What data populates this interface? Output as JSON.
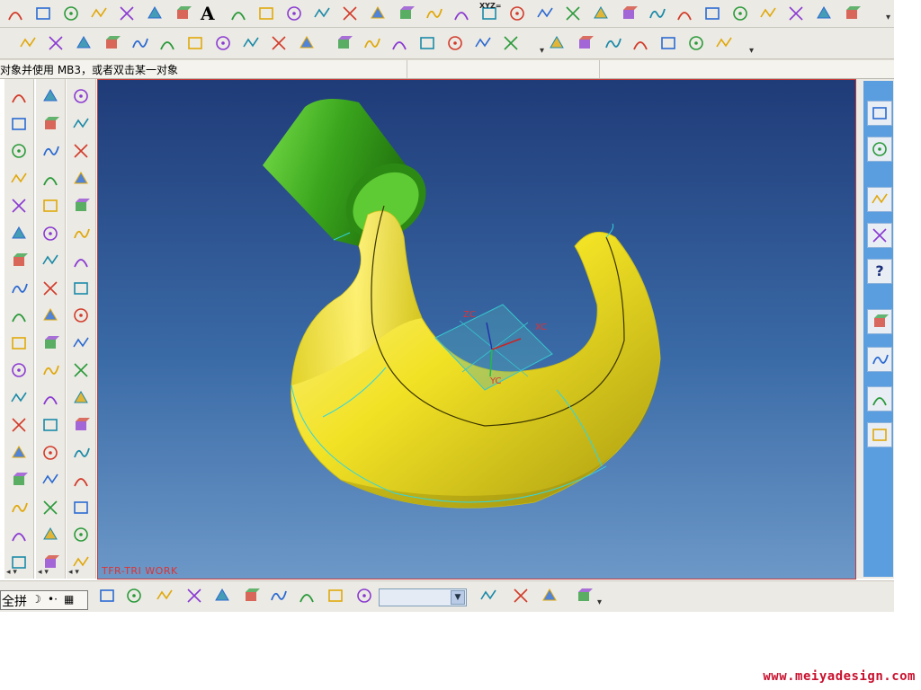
{
  "top_toolbar_1": {
    "icons": [
      "arc-icon",
      "helix-icon",
      "spline-icon",
      "curve-icon",
      "wave-icon",
      "polyline-icon",
      "sketch-icon",
      "text-icon",
      "point-icon",
      "point-set-icon",
      "fillet-curve-icon",
      "rectangle-icon",
      "polygon-icon",
      "circle-icon",
      "intersection-icon",
      "trim-icon",
      "chamfer-curve-icon",
      "xyz-expression-icon",
      "law-curve-icon",
      "offset-curve-icon",
      "bridge-curve-icon",
      "project-curve-icon",
      "combined-curve-icon",
      "wrap-curve-icon",
      "extract-curve-icon",
      "section-curve-icon",
      "isoparametric-icon",
      "mirror-curve-icon",
      "divide-curve-icon",
      "edit-parameters-icon",
      "pencil-icon"
    ],
    "text_icon_label": "A",
    "xyz_label": "XYZ="
  },
  "top_toolbar_2": {
    "icons": [
      "line-icon",
      "line-angle-icon",
      "line-parallel-icon",
      "line-normal-icon",
      "arc-3point-icon",
      "arc-tangent-icon",
      "grid-curve-icon",
      "arc-edit-icon",
      "line-edit-icon",
      "trim-corner-icon",
      "trim-edge-icon",
      "circle-center-icon",
      "circle-3point-icon",
      "square-circle-icon",
      "circle-tangent-icon",
      "point-center-icon",
      "circle-radius-icon",
      "circle-dash-icon",
      "line-slash-icon",
      "line-dash-icon",
      "curve-edit-icon",
      "perpendicular-icon",
      "circle-outline-icon",
      "circle-plus-icon",
      "cross-icon"
    ]
  },
  "status_bar": {
    "prompt": "对象并使用 MB3，或者双击某一对象"
  },
  "left_toolbar_columns": [
    {
      "icons": [
        "mesh-surface-icon",
        "through-points-icon",
        "from-poles-icon",
        "ruled-surface-icon",
        "through-curves-icon",
        "curve-mesh-icon",
        "swept-icon",
        "section-surface-icon",
        "bridge-surface-icon",
        "n-sided-icon",
        "extension-icon",
        "law-extension-icon",
        "offset-surface-icon",
        "rough-offset-icon",
        "transition-icon",
        "trimmed-sheet-icon",
        "quilt-icon",
        "silhouette-flange-icon"
      ]
    },
    {
      "icons": [
        "extrude-icon",
        "revolve-icon",
        "block-icon",
        "sweep-icon",
        "cylinder-icon",
        "cone-icon",
        "tube-icon",
        "rib-icon",
        "hole-icon",
        "boss-icon",
        "pocket-icon",
        "pad-icon",
        "slot-icon",
        "groove-icon",
        "thread-icon",
        "emboss-icon",
        "blend-icon",
        "face-blend-icon",
        "chamfer-icon"
      ]
    },
    {
      "icons": [
        "part-navigator-icon",
        "assembly-icon",
        "feature-icon",
        "draft-icon",
        "pipe-icon",
        "shell-icon",
        "boolean-unite-icon",
        "boolean-subtract-icon",
        "boolean-intersect-icon",
        "offset-face-icon",
        "scale-body-icon",
        "trim-body-icon",
        "split-body-icon",
        "sew-icon",
        "patch-icon",
        "simplify-icon",
        "wrap-geometry-icon",
        "promote-icon"
      ]
    }
  ],
  "viewport": {
    "work_layer_label": "TFR-TRI WORK",
    "axis_labels": {
      "z": "ZC",
      "x": "XC",
      "y": "YC"
    }
  },
  "right_resource_bar": {
    "icons": [
      "assembly-navigator-icon",
      "part-navigator-icon",
      "web-browser-icon",
      "training-icon",
      "help-icon",
      "history-icon",
      "system-materials-icon",
      "process-studio-icon",
      "roles-icon"
    ],
    "help_label": "?"
  },
  "bottom_toolbar": {
    "ime_labels": [
      "全拼"
    ],
    "icons": [
      "assembly-load-icon",
      "assembly-clone-icon",
      "add-component-icon",
      "mate-component-icon",
      "reposition-icon",
      "exploded-view-icon",
      "component-array-icon",
      "replace-component-icon",
      "wave-link-icon",
      "assembly-sequence-icon",
      "tools-icon",
      "component-pattern-icon",
      "check-clearance-icon",
      "link-icon",
      "check-icon"
    ],
    "dropdown_value": ""
  },
  "watermark": "www.meiyadesign.com",
  "colors": {
    "hook_yellow": "#f2e225",
    "cylinder_green": "#3aa51d",
    "viewport_top": "#1f3b78",
    "viewport_bottom": "#6c98c8",
    "edge_cyan": "#33d6e0",
    "watermark_red": "#c8102e"
  }
}
